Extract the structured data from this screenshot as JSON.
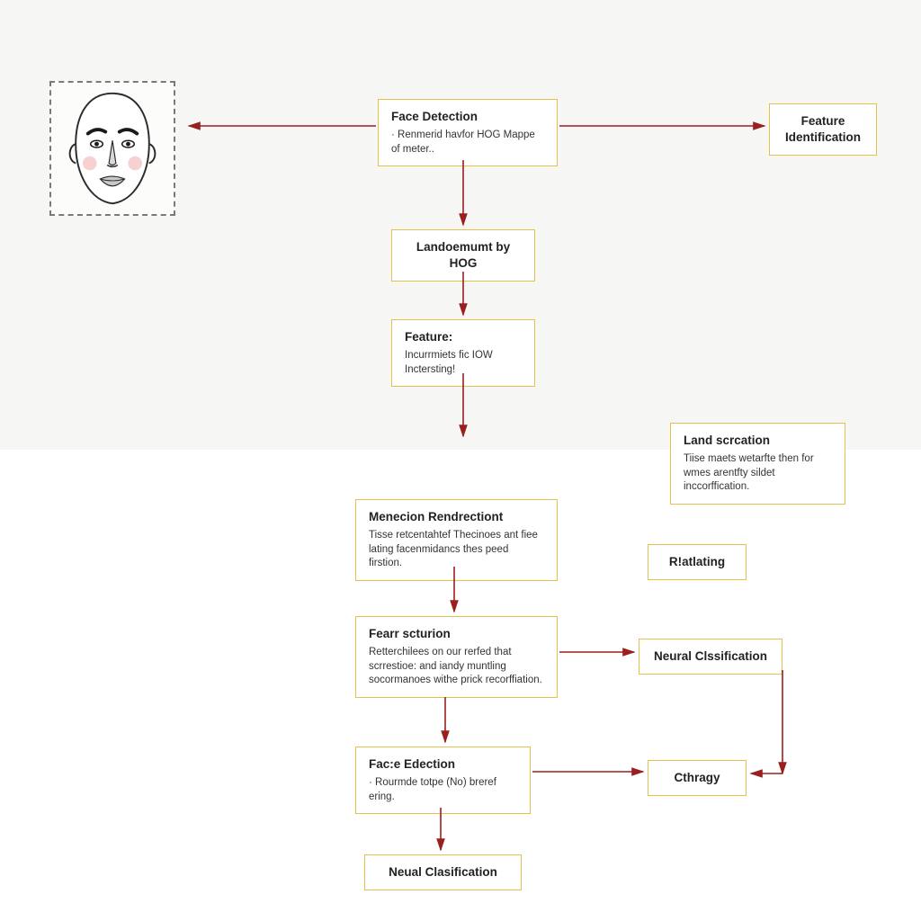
{
  "diagram": {
    "type": "flowchart",
    "arrow_color": "#9a1f1f",
    "node_border_color": "#e3c14a",
    "face_box": {
      "description": "line-drawn face illustration inside dashed bounding box",
      "icon": "face-illustration"
    },
    "nodes": {
      "face_detection": {
        "title": "Face Detection",
        "body": "· Renmerid havfor HOG  Mappe of meter.."
      },
      "feature_identification": {
        "title": "Feature Identification"
      },
      "landmark_hog": {
        "title": "Landoemumt by HOG"
      },
      "feature": {
        "title": "Feature:",
        "body": "Incurrmiets fic IOW Inctersting!"
      },
      "land_scrcation": {
        "title": "Land scrcation",
        "body": "Tiise maets wetarfte then for wmes arentfty sildet inccorffication."
      },
      "menecion": {
        "title": "Menecion Rendrectiont",
        "body": "Tisse retcentahtef Thecinoes ant fiee lating facenmidancs thes peed firstion."
      },
      "rlatlating": {
        "title": "R!atlating"
      },
      "fearr": {
        "title": "Fearr scturion",
        "body": "Retterchilees on our rerfed that scrrestioe: and iandy muntling socormanoes withe prick recorffiation."
      },
      "neural_class_1": {
        "title": "Neural Clssification"
      },
      "face_edection": {
        "title": "Fac:e Edection",
        "body": "·  Rourmde totpe (No)  breref ering."
      },
      "cthragy": {
        "title": "Cthragy"
      },
      "neural_class_2": {
        "title": "Neual Clasification"
      }
    }
  }
}
